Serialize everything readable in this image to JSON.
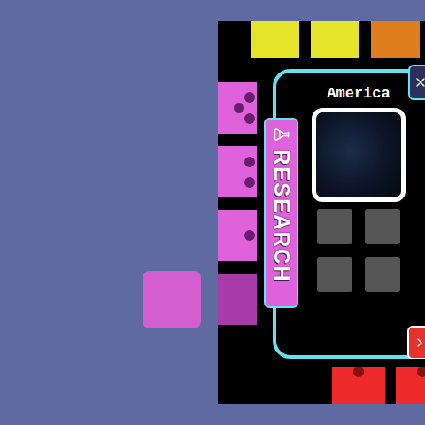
{
  "top_cards": [
    {
      "color": "#e6e52c"
    },
    {
      "color": "#e6e52c"
    },
    {
      "color": "#dd7d1d"
    }
  ],
  "research_stack": [
    {
      "cubes": 3,
      "color": "#dd62dc"
    },
    {
      "cubes": 2,
      "color": "#dd62dc"
    },
    {
      "cubes": 1,
      "color": "#dd62dc"
    },
    {
      "cubes": 0,
      "color": "#a73ca8"
    }
  ],
  "held_card": {
    "color": "#d35fcf"
  },
  "research_panel": {
    "tab": "RESEARCH",
    "region": "America",
    "slots": [
      {
        "filled": false
      },
      {
        "filled": false
      },
      {
        "filled": false
      },
      {
        "filled": false
      }
    ]
  },
  "bottom_cards": [
    {
      "cubes": 1,
      "color": "#ee2a2a"
    },
    {
      "cubes": 1,
      "color": "#ee2a2a"
    }
  ]
}
